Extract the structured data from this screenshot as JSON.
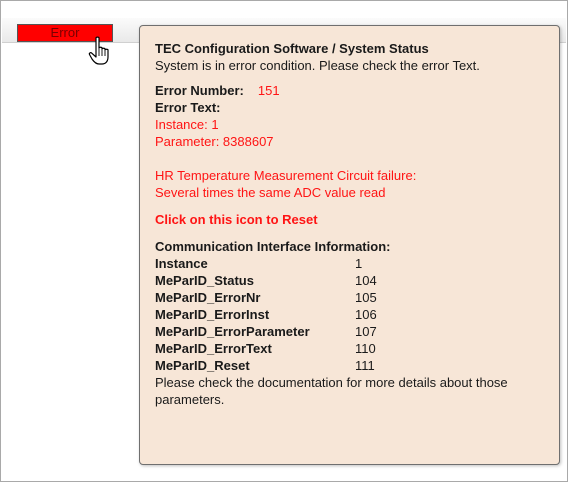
{
  "error_button": {
    "label": "Error",
    "color": "#ff0000"
  },
  "tooltip": {
    "title": "TEC Configuration Software / System Status",
    "subtitle": "System is in error condition. Please check the error Text.",
    "error_number_label": "Error Number:",
    "error_number_value": "151",
    "error_text_label": "Error Text:",
    "instance_line": "Instance: 1",
    "parameter_line": "Parameter: 8388607",
    "failure_line1": "HR Temperature Measurement Circuit failure:",
    "failure_line2": "Several times the same ADC value read",
    "reset_hint": "Click on this icon to Reset",
    "comm_header": "Communication Interface Information:",
    "comm_rows": [
      {
        "key": "Instance",
        "value": "1"
      },
      {
        "key": "MeParID_Status",
        "value": "104"
      },
      {
        "key": "MeParID_ErrorNr",
        "value": "105"
      },
      {
        "key": "MeParID_ErrorInst",
        "value": "106"
      },
      {
        "key": "MeParID_ErrorParameter",
        "value": "107"
      },
      {
        "key": "MeParID_ErrorText",
        "value": "110"
      },
      {
        "key": "MeParID_Reset",
        "value": "111"
      }
    ],
    "footer_line1": "Please check the documentation for more details about those",
    "footer_line2": "parameters.",
    "background": "#f7e6d7",
    "error_color": "#ff1414"
  },
  "cursor": {
    "icon": "hand-pointer-icon"
  }
}
